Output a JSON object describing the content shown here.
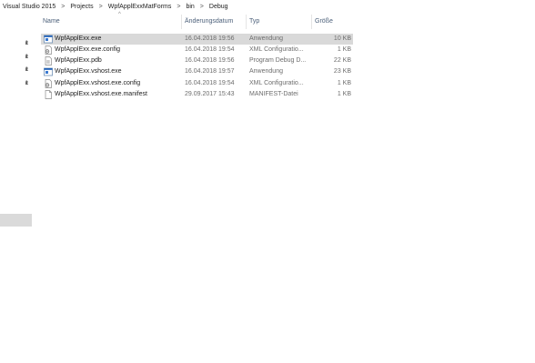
{
  "breadcrumb": [
    "Visual Studio 2015",
    "Projects",
    "WpfApplExxMatForms",
    "bin",
    "Debug"
  ],
  "columns": {
    "name": "Name",
    "date": "Änderungsdatum",
    "type": "Typ",
    "size": "Größe"
  },
  "files": [
    {
      "name": "WpfApplExx.exe",
      "date": "16.04.2018 19:56",
      "type": "Anwendung",
      "size": "10 KB",
      "icon": "exe-icon",
      "selected": true
    },
    {
      "name": "WpfApplExx.exe.config",
      "date": "16.04.2018 19:54",
      "type": "XML Configuratio...",
      "size": "1 KB",
      "icon": "config-icon",
      "selected": false
    },
    {
      "name": "WpfApplExx.pdb",
      "date": "16.04.2018 19:56",
      "type": "Program Debug D...",
      "size": "22 KB",
      "icon": "pdb-icon",
      "selected": false
    },
    {
      "name": "WpfApplExx.vshost.exe",
      "date": "16.04.2018 19:57",
      "type": "Anwendung",
      "size": "23 KB",
      "icon": "exe-icon",
      "selected": false
    },
    {
      "name": "WpfApplExx.vshost.exe.config",
      "date": "16.04.2018 19:54",
      "type": "XML Configuratio...",
      "size": "1 KB",
      "icon": "config-icon",
      "selected": false
    },
    {
      "name": "WpfApplExx.vshost.exe.manifest",
      "date": "29.09.2017 15:43",
      "type": "MANIFEST-Datei",
      "size": "1 KB",
      "icon": "file-icon",
      "selected": false
    }
  ],
  "colors": {
    "selected_row": "#d9d9d9",
    "header_text": "#4c607a",
    "exe_blue": "#1f5fb5"
  }
}
